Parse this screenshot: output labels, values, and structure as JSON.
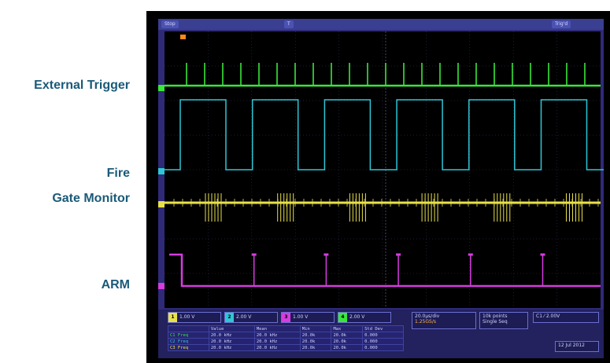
{
  "labels": {
    "external_trigger": "External Trigger",
    "fire": "Fire",
    "gate_monitor": "Gate Monitor",
    "arm": "ARM"
  },
  "scope": {
    "colors": {
      "screen_bg": "#2f2a78",
      "plot_bg": "#000000",
      "ch1_trigger": "#39e63a",
      "ch2_fire": "#2fc6d6",
      "ch3_gate": "#e8e04a",
      "ch4_arm": "#d63ce0",
      "grid": "#3a3a6a"
    },
    "topbar": {
      "left_text": "Stop",
      "mid_text": "T",
      "right_text": "Trig'd"
    },
    "channels": [
      {
        "tag": "1",
        "label": "1.00 V"
      },
      {
        "tag": "2",
        "label": "2.00 V"
      },
      {
        "tag": "3",
        "label": "1.00 V"
      },
      {
        "tag": "4",
        "label": "2.00 V"
      }
    ],
    "measurements": {
      "headers": [
        "",
        "Value",
        "Mean",
        "Min",
        "Max",
        "Std Dev"
      ],
      "rows": [
        [
          "C1 Freq",
          "20.0 kHz",
          "20.0 kHz",
          "20.0k",
          "20.0k",
          "0.000"
        ],
        [
          "C2 Freq",
          "20.0 kHz",
          "20.0 kHz",
          "20.0k",
          "20.0k",
          "0.000"
        ],
        [
          "C3 Freq",
          "20.0 kHz",
          "20.0 kHz",
          "20.0k",
          "20.0k",
          "0.000"
        ]
      ]
    },
    "right_boxes": {
      "timebase": "20.0µs/div",
      "timebase_sub": "1.25GS/s",
      "record": "10k points",
      "record_sub": "Single Seq",
      "trigger": "C1 ⁄ 2.00V",
      "corner": "12 Jul 2012"
    }
  }
}
